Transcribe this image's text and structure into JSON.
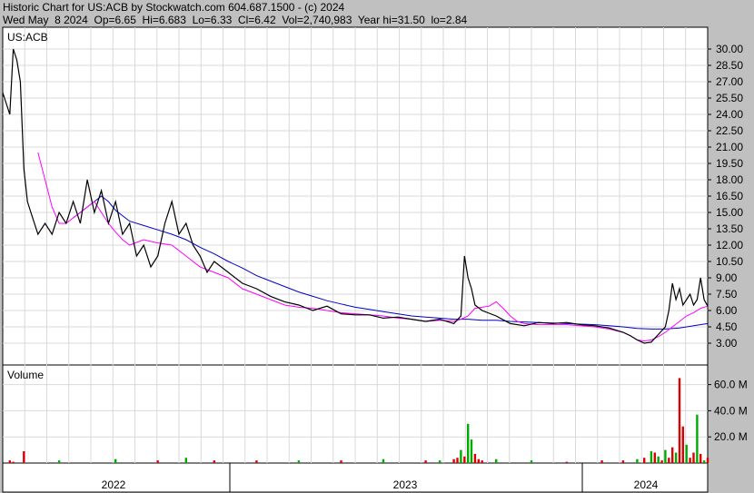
{
  "header": {
    "line1": "Historic Chart for US:ACB by Stockwatch.com 604.687.1500 - (c) 2024",
    "line2": "Wed May  8 2024  Op=6.65  Hi=6.683  Lo=6.33  Cl=6.42  Vol=2,740,983  Year hi=31.50  lo=2.84"
  },
  "price_panel": {
    "symbol": "US:ACB"
  },
  "volume_panel": {
    "title": "Volume"
  },
  "colors": {
    "background": "#c0c0c0",
    "plot_bg": "#ffffff",
    "grid": "#d9d9d9",
    "price": "#000000",
    "ma_fast": "#ff00ff",
    "ma_slow": "#0000cc",
    "vol_up": "#00aa00",
    "vol_down": "#dd0000"
  },
  "chart_data": {
    "type": "line",
    "x_axis": {
      "labels": [
        "2022",
        "2023",
        "2024"
      ]
    },
    "y_axis_price": {
      "min": 1.0,
      "max": 32.0,
      "ticks": [
        3.0,
        4.5,
        6.0,
        7.5,
        9.0,
        10.5,
        12.0,
        13.5,
        15.0,
        16.5,
        18.0,
        19.5,
        21.0,
        22.5,
        24.0,
        25.5,
        27.0,
        28.5,
        30.0
      ]
    },
    "y_axis_volume": {
      "min": 0,
      "max": 75,
      "ticks": [
        "20.0 M",
        "40.0 M",
        "60.0 M"
      ],
      "tick_values": [
        20,
        40,
        60
      ]
    },
    "x_range": [
      0,
      100
    ],
    "price_series": {
      "name": "Price",
      "x": [
        0,
        1,
        1.5,
        2,
        2.5,
        3,
        3.5,
        4,
        5,
        6,
        7,
        8,
        9,
        10,
        11,
        12,
        13,
        14,
        15,
        16,
        17,
        18,
        19,
        20,
        21,
        22,
        23,
        24,
        25,
        26,
        27,
        28,
        29,
        30,
        32,
        34,
        36,
        38,
        40,
        42,
        44,
        46,
        48,
        50,
        52,
        54,
        56,
        58,
        60,
        62,
        64,
        65,
        65.5,
        66,
        66.5,
        67,
        68,
        70,
        72,
        74,
        76,
        78,
        80,
        82,
        84,
        86,
        88,
        89,
        90,
        91,
        92,
        93,
        94,
        94.5,
        95,
        95.5,
        96,
        96.5,
        97,
        97.5,
        98,
        98.5,
        99,
        99.5,
        100
      ],
      "y": [
        26,
        24,
        30,
        29,
        27,
        19,
        16,
        15,
        13,
        14,
        13,
        15,
        14,
        16,
        14,
        18,
        15,
        17,
        14,
        16,
        13,
        14,
        11,
        12,
        10,
        11,
        14,
        16,
        13,
        14,
        12,
        11,
        9.5,
        10.5,
        9.5,
        8.5,
        8.0,
        7.3,
        6.8,
        6.5,
        6.0,
        6.4,
        5.7,
        5.6,
        5.6,
        5.3,
        5.4,
        5.2,
        5.0,
        5.2,
        4.8,
        5.5,
        11.0,
        9.0,
        8.0,
        6.5,
        6.0,
        5.5,
        4.8,
        4.6,
        4.9,
        4.8,
        4.9,
        4.7,
        4.6,
        4.4,
        4.0,
        3.7,
        3.3,
        3.0,
        3.1,
        3.8,
        4.5,
        6.0,
        8.5,
        7.0,
        8.0,
        6.5,
        7.0,
        7.5,
        6.5,
        7.0,
        9.0,
        7.0,
        6.4
      ]
    },
    "series": [
      {
        "x": [
          5,
          6,
          7,
          8,
          9,
          10,
          11,
          12,
          13,
          14,
          15,
          16,
          17,
          18,
          20,
          22,
          24,
          26,
          28,
          30,
          32,
          34,
          36,
          38,
          40,
          42,
          44,
          46,
          48,
          50,
          52,
          54,
          56,
          58,
          60,
          62,
          64,
          65,
          66,
          67,
          68,
          69,
          70,
          71,
          72,
          73,
          74,
          76,
          78,
          80,
          82,
          84,
          86,
          88,
          89,
          90,
          91,
          92,
          93,
          94,
          95,
          96,
          97,
          98,
          99,
          100
        ],
        "y": [
          20.5,
          18.0,
          15.5,
          14.0,
          14.0,
          14.5,
          15.0,
          15.5,
          16.0,
          15.0,
          14.0,
          13.2,
          12.5,
          12.0,
          12.5,
          12.2,
          12.0,
          11.0,
          10.0,
          9.5,
          9.0,
          8.0,
          7.5,
          7.0,
          6.5,
          6.3,
          6.2,
          6.0,
          5.8,
          5.7,
          5.6,
          5.5,
          5.3,
          5.2,
          5.0,
          5.1,
          5.0,
          5.2,
          5.5,
          6.2,
          6.3,
          6.4,
          6.8,
          6.2,
          5.5,
          5.0,
          4.8,
          4.7,
          4.7,
          4.7,
          4.6,
          4.5,
          4.3,
          4.0,
          3.7,
          3.3,
          3.2,
          3.3,
          3.6,
          4.0,
          4.5,
          5.0,
          5.5,
          5.8,
          6.2,
          6.4
        ]
      },
      {
        "x": [
          10,
          11,
          12,
          13,
          14,
          15,
          16,
          17,
          18,
          20,
          22,
          24,
          26,
          28,
          30,
          32,
          34,
          36,
          38,
          40,
          42,
          44,
          46,
          48,
          50,
          52,
          54,
          56,
          58,
          60,
          62,
          64,
          66,
          68,
          70,
          72,
          74,
          76,
          78,
          80,
          82,
          84,
          86,
          88,
          90,
          92,
          94,
          96,
          98,
          100
        ],
        "y": [
          14.5,
          15.0,
          15.5,
          16.0,
          16.5,
          16.0,
          15.2,
          14.7,
          14.2,
          13.8,
          13.4,
          13.0,
          12.5,
          11.8,
          11.2,
          10.5,
          9.9,
          9.2,
          8.7,
          8.2,
          7.7,
          7.3,
          6.9,
          6.6,
          6.3,
          6.1,
          5.9,
          5.7,
          5.5,
          5.4,
          5.3,
          5.2,
          5.2,
          5.1,
          5.1,
          5.0,
          4.95,
          4.9,
          4.85,
          4.8,
          4.75,
          4.7,
          4.6,
          4.5,
          4.35,
          4.3,
          4.3,
          4.4,
          4.6,
          4.8
        ]
      }
    ],
    "volume_series": {
      "name": "Volume",
      "x": [
        1,
        1.5,
        3,
        8,
        16,
        22,
        26,
        30,
        36,
        42,
        48,
        54,
        60,
        62,
        64,
        64.5,
        65,
        65.5,
        66,
        66.5,
        67,
        67.5,
        68,
        70,
        75,
        80,
        85,
        88,
        90,
        91,
        92,
        92.5,
        93,
        93.5,
        94,
        94.5,
        95,
        95.5,
        96,
        96.5,
        97,
        97.5,
        98,
        98.5,
        99,
        99.5,
        100
      ],
      "values": [
        2,
        1,
        9,
        2,
        3,
        2,
        4,
        2,
        2,
        2,
        2,
        3,
        2,
        2,
        3,
        4,
        10,
        5,
        30,
        18,
        7,
        3,
        2,
        3,
        2,
        1,
        2,
        2,
        3,
        4,
        9,
        8,
        5,
        2,
        10,
        4,
        12,
        8,
        65,
        28,
        14,
        4,
        8,
        37,
        7,
        2,
        4
      ],
      "up": [
        false,
        false,
        false,
        true,
        true,
        false,
        true,
        false,
        false,
        true,
        false,
        true,
        false,
        true,
        false,
        false,
        true,
        false,
        true,
        true,
        false,
        false,
        false,
        true,
        true,
        false,
        false,
        false,
        true,
        false,
        true,
        false,
        true,
        false,
        true,
        false,
        false,
        true,
        false,
        false,
        true,
        false,
        false,
        true,
        false,
        true,
        false
      ]
    }
  }
}
